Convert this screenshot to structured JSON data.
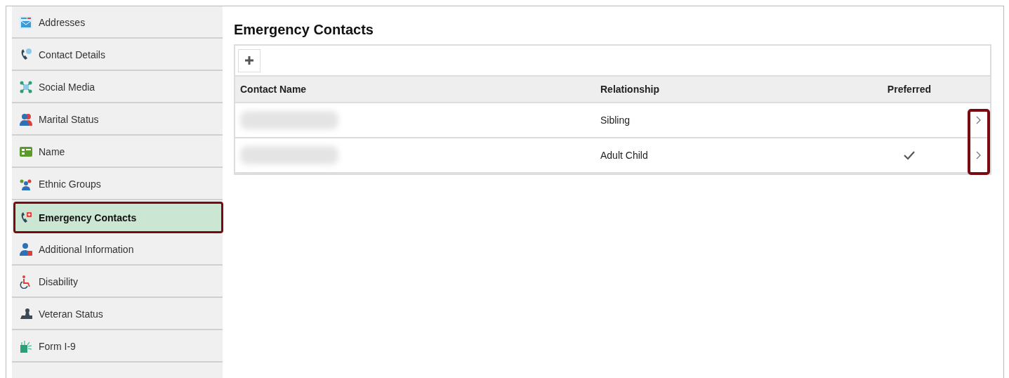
{
  "sidebar": {
    "items": [
      {
        "label": "Addresses",
        "selected": false
      },
      {
        "label": "Contact Details",
        "selected": false
      },
      {
        "label": "Social Media",
        "selected": false
      },
      {
        "label": "Marital Status",
        "selected": false
      },
      {
        "label": "Name",
        "selected": false
      },
      {
        "label": "Ethnic Groups",
        "selected": false
      },
      {
        "label": "Emergency Contacts",
        "selected": true
      },
      {
        "label": "Additional Information",
        "selected": false
      },
      {
        "label": "Disability",
        "selected": false
      },
      {
        "label": "Veteran Status",
        "selected": false
      },
      {
        "label": "Form I-9",
        "selected": false
      }
    ]
  },
  "page_title": "Emergency Contacts",
  "table": {
    "columns": [
      "Contact Name",
      "Relationship",
      "Preferred"
    ],
    "detail_column_highlighted": true,
    "rows": [
      {
        "relationship": "Sibling",
        "preferred": false
      },
      {
        "relationship": "Adult Child",
        "preferred": true
      }
    ]
  }
}
